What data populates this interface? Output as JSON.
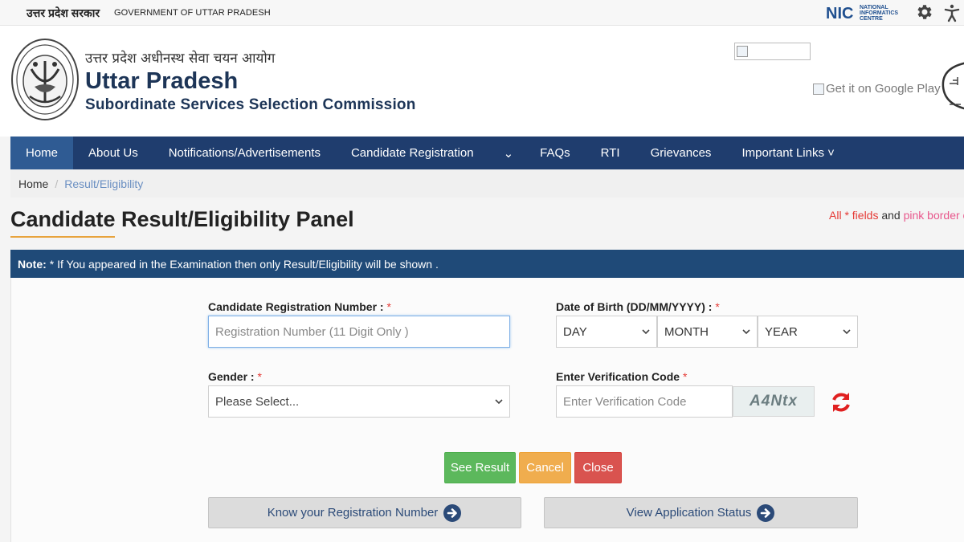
{
  "topbar": {
    "hindi_gov": "उत्तर प्रदेश सरकार",
    "english_gov": "GOVERNMENT OF UTTAR PRADESH",
    "nic_logo_text": "NIC",
    "nic_logo_sub": [
      "NATIONAL",
      "INFORMATICS",
      "CENTRE"
    ]
  },
  "header": {
    "title_hindi": "उत्तर प्रदेश अधीनस्थ सेवा चयन आयोग",
    "title_main": "Uttar Pradesh",
    "title_sub": "Subordinate Services Selection Commission",
    "google_play_alt": "Get it on Google Play"
  },
  "nav": {
    "items": [
      {
        "label": "Home",
        "active": true
      },
      {
        "label": "About Us"
      },
      {
        "label": "Notifications/Advertisements"
      },
      {
        "label": "Candidate Registration"
      },
      {
        "label": "⌄"
      },
      {
        "label": "FAQs"
      },
      {
        "label": "RTI"
      },
      {
        "label": "Grievances"
      },
      {
        "label": "Important Links ˅"
      }
    ]
  },
  "breadcrumb": {
    "home": "Home",
    "separator": "/",
    "current": "Result/Eligibility"
  },
  "panel": {
    "title": "Candidate Result/Eligibility Panel",
    "required_note_star": "All * fields",
    "required_note_and": " and ",
    "required_note_pink": "pink border co"
  },
  "note": {
    "label": "Note:",
    "text": "* If You appeared in the Examination then only Result/Eligibility will be shown ."
  },
  "form": {
    "reg_label": "Candidate Registration Number :",
    "reg_placeholder": "Registration Number (11 Digit Only )",
    "dob_label": "Date of Birth (DD/MM/YYYY) :",
    "day": "DAY",
    "month": "MONTH",
    "year": "YEAR",
    "gender_label": "Gender :",
    "gender_value": "Please Select...",
    "verify_label": "Enter Verification Code",
    "verify_placeholder": "Enter Verification Code",
    "captcha": "A4Ntx",
    "required_star": "*"
  },
  "buttons": {
    "see_result": "See Result",
    "cancel": "Cancel",
    "close": "Close",
    "know_reg": "Know your Registration Number",
    "view_status": "View Application Status"
  },
  "colors": {
    "navbar": "#1f3d6e",
    "nav_active": "#2f5b93",
    "title_blue": "#1d3557",
    "accent_orange": "#e8a33d",
    "note_bar": "#1f4a78",
    "green": "#5cb85c",
    "orange": "#f0ad4e",
    "red": "#d9534f"
  }
}
